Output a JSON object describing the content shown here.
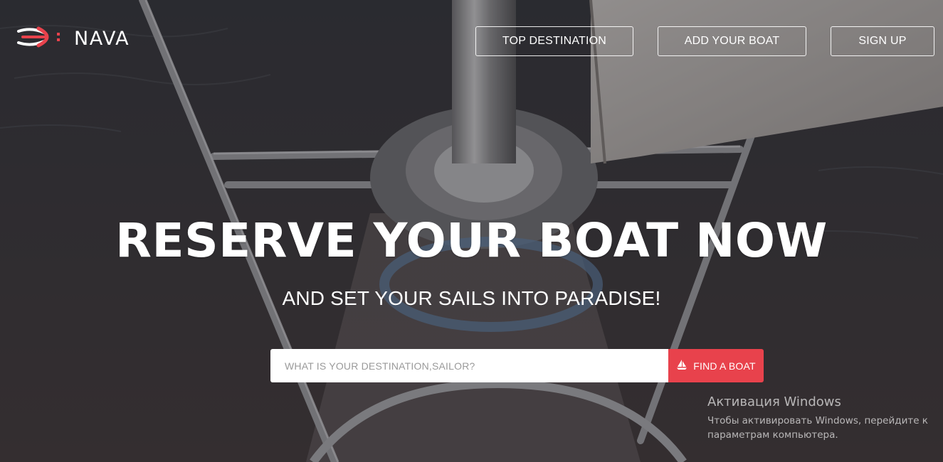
{
  "brand": {
    "name": "NAVA",
    "accent_color": "#e8424c",
    "logo_icon": "boat-knot-icon"
  },
  "nav": {
    "top_destination": "TOP DESTINATION",
    "add_your_boat": "ADD YOUR BOAT",
    "sign_up": "SIGN UP"
  },
  "hero": {
    "headline": "RESERVE YOUR BOAT NOW",
    "subheadline": "AND SET YOUR SAILS INTO PARADISE!",
    "background": "sailboat-deck-photo"
  },
  "search": {
    "placeholder": "WHAT IS YOUR DESTINATION,SAILOR?",
    "value": "",
    "button_label": "FIND A BOAT",
    "button_icon": "sailboat-icon"
  },
  "watermark": {
    "title": "Активация Windows",
    "line1": "Чтобы активировать Windows, перейдите к",
    "line2": "параметрам компьютера."
  }
}
